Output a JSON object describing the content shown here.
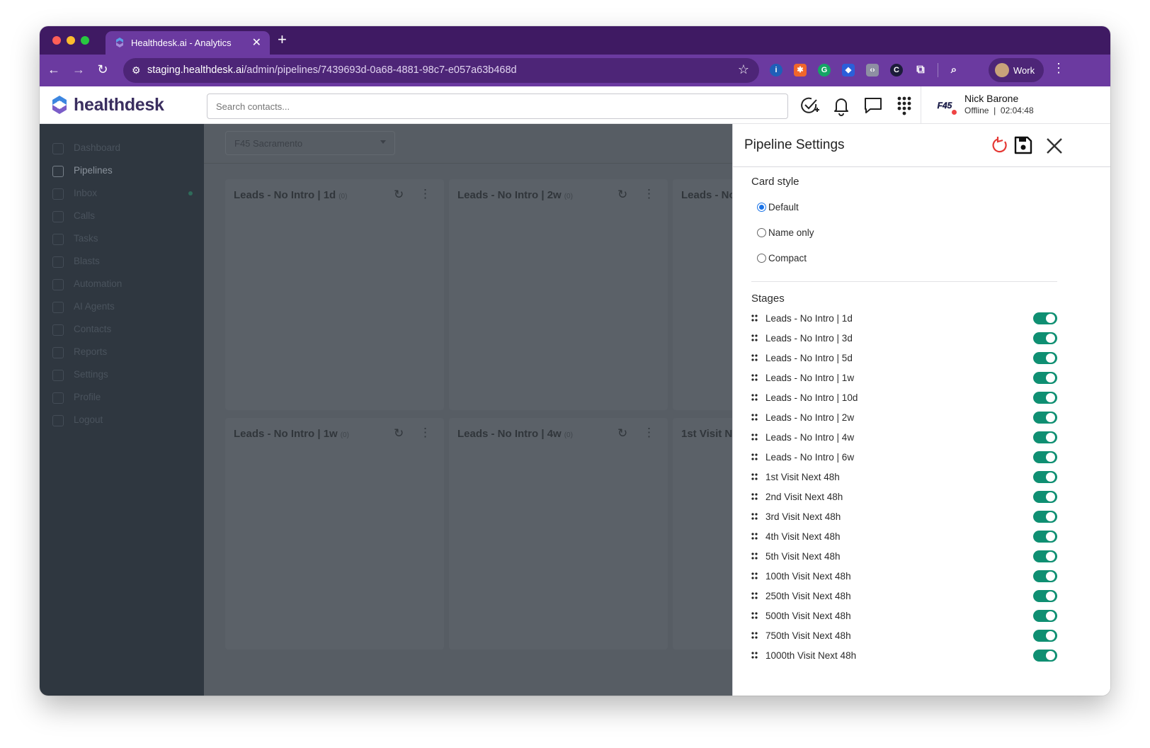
{
  "browser": {
    "tab_title": "Healthdesk.ai - Analytics",
    "url_host": "staging.healthdesk.ai",
    "url_path": "/admin/pipelines/7439693d-0a68-4881-98c7-e057a63b468d",
    "profile_label": "Work",
    "chrome_color": "#6b3aa0"
  },
  "header": {
    "brand": "healthdesk",
    "search_placeholder": "Search contacts...",
    "user_name": "Nick Barone",
    "user_status": "Offline  |  02:04:48",
    "user_org_logo": "F45",
    "status_color": "#ef4444"
  },
  "sidebar": {
    "items": [
      {
        "label": "Dashboard",
        "icon": "dashboard-icon"
      },
      {
        "label": "Pipelines",
        "icon": "pipelines-icon"
      },
      {
        "label": "Inbox",
        "icon": "inbox-icon"
      },
      {
        "label": "Calls",
        "icon": "phone-icon"
      },
      {
        "label": "Tasks",
        "icon": "tasks-icon"
      },
      {
        "label": "Blasts",
        "icon": "megaphone-icon"
      },
      {
        "label": "Automation",
        "icon": "automation-icon"
      },
      {
        "label": "AI Agents",
        "icon": "robot-icon"
      },
      {
        "label": "Contacts",
        "icon": "contacts-icon"
      },
      {
        "label": "Reports",
        "icon": "reports-icon"
      },
      {
        "label": "Settings",
        "icon": "gear-icon"
      },
      {
        "label": "Profile",
        "icon": "user-icon"
      },
      {
        "label": "Logout",
        "icon": "logout-icon"
      }
    ],
    "active": "Pipelines"
  },
  "main": {
    "location": "F45 Sacramento",
    "columns": [
      {
        "title": "Leads - No Intro | 1d",
        "count": "(0)"
      },
      {
        "title": "Leads - No Intro | 2w",
        "count": "(0)"
      },
      {
        "title": "Leads - No Intro | 1w",
        "count": "(0)"
      },
      {
        "title": "Leads - No Intro | 4w",
        "count": "(0)"
      },
      {
        "title": "Leads - No Intro | 3d",
        "count": "(0)"
      },
      {
        "title": "1st Visit Next 48h",
        "count": "(0)"
      }
    ]
  },
  "panel": {
    "title": "Pipeline Settings",
    "card_style_heading": "Card style",
    "card_style_options": [
      "Default",
      "Name only",
      "Compact"
    ],
    "card_style_selected": "Default",
    "stages_heading": "Stages",
    "stages": [
      {
        "name": "Leads - No Intro | 1d",
        "enabled": true
      },
      {
        "name": "Leads - No Intro | 3d",
        "enabled": true
      },
      {
        "name": "Leads - No Intro | 5d",
        "enabled": true
      },
      {
        "name": "Leads - No Intro | 1w",
        "enabled": true
      },
      {
        "name": "Leads - No Intro | 10d",
        "enabled": true
      },
      {
        "name": "Leads - No Intro | 2w",
        "enabled": true
      },
      {
        "name": "Leads - No Intro | 4w",
        "enabled": true
      },
      {
        "name": "Leads - No Intro | 6w",
        "enabled": true
      },
      {
        "name": "1st Visit Next 48h",
        "enabled": true
      },
      {
        "name": "2nd Visit Next 48h",
        "enabled": true
      },
      {
        "name": "3rd Visit Next 48h",
        "enabled": true
      },
      {
        "name": "4th Visit Next 48h",
        "enabled": true
      },
      {
        "name": "5th Visit Next 48h",
        "enabled": true
      },
      {
        "name": "100th Visit Next 48h",
        "enabled": true
      },
      {
        "name": "250th Visit Next 48h",
        "enabled": true
      },
      {
        "name": "500th Visit Next 48h",
        "enabled": true
      },
      {
        "name": "750th Visit Next 48h",
        "enabled": true
      },
      {
        "name": "1000th Visit Next 48h",
        "enabled": true
      }
    ],
    "toggle_color": "#0f8f72"
  }
}
